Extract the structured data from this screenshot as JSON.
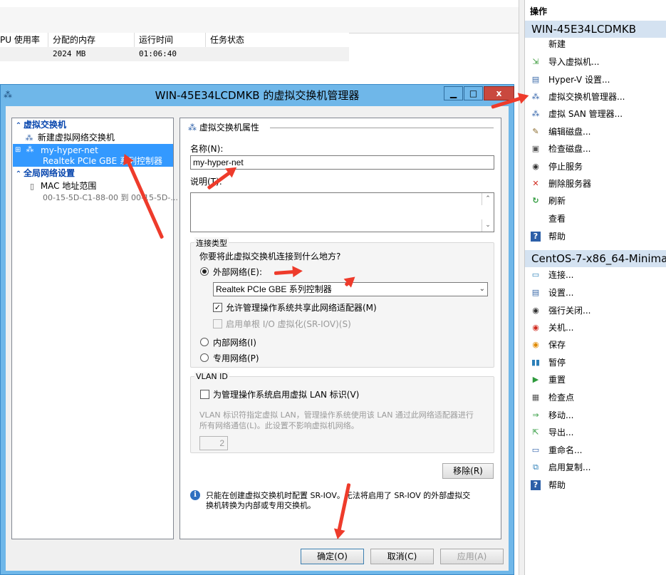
{
  "background": {
    "columns": [
      "PU 使用率",
      "分配的内存",
      "运行时间",
      "任务状态"
    ],
    "row": [
      "",
      "2024 MB",
      "01:06:40",
      ""
    ]
  },
  "actions": {
    "header": "操作",
    "host_group": "WIN-45E34LCDMKB",
    "host_items": [
      {
        "label": "新建",
        "icon": ""
      },
      {
        "label": "导入虚拟机...",
        "icon": "import-icon"
      },
      {
        "label": "Hyper-V 设置...",
        "icon": "settings-icon"
      },
      {
        "label": "虚拟交换机管理器...",
        "icon": "switch-manager-icon"
      },
      {
        "label": "虚拟 SAN 管理器...",
        "icon": "san-icon"
      },
      {
        "label": "编辑磁盘...",
        "icon": "edit-disk-icon"
      },
      {
        "label": "检查磁盘...",
        "icon": "inspect-disk-icon"
      },
      {
        "label": "停止服务",
        "icon": "stop-icon"
      },
      {
        "label": "删除服务器",
        "icon": "delete-icon"
      },
      {
        "label": "刷新",
        "icon": "refresh-icon"
      },
      {
        "label": "查看",
        "icon": ""
      },
      {
        "label": "帮助",
        "icon": "help-icon"
      }
    ],
    "vm_group": "CentOS-7-x86_64-Minimal",
    "vm_items": [
      {
        "label": "连接...",
        "icon": "connect-icon"
      },
      {
        "label": "设置...",
        "icon": "settings-icon"
      },
      {
        "label": "强行关闭...",
        "icon": "turn-off-icon"
      },
      {
        "label": "关机...",
        "icon": "shutdown-icon"
      },
      {
        "label": "保存",
        "icon": "save-icon"
      },
      {
        "label": "暂停",
        "icon": "pause-icon"
      },
      {
        "label": "重置",
        "icon": "reset-icon"
      },
      {
        "label": "检查点",
        "icon": "checkpoint-icon"
      },
      {
        "label": "移动...",
        "icon": "move-icon"
      },
      {
        "label": "导出...",
        "icon": "export-icon"
      },
      {
        "label": "重命名...",
        "icon": "rename-icon"
      },
      {
        "label": "启用复制...",
        "icon": "replication-icon"
      },
      {
        "label": "帮助",
        "icon": "help-icon"
      }
    ]
  },
  "dialog": {
    "title": "WIN-45E34LCDMKB 的虚拟交换机管理器",
    "minimize": "▁",
    "maximize": "□",
    "close": "x",
    "tree": {
      "section1": "虚拟交换机",
      "new_switch": "新建虚拟网络交换机",
      "switch_name": "my-hyper-net",
      "switch_adapter": "Realtek PCIe GBE 系列控制器",
      "section2": "全局网络设置",
      "mac_range": "MAC 地址范围",
      "mac_value": "00-15-5D-C1-88-00 到 00-15-5D-..."
    },
    "props": {
      "title": "虚拟交换机属性",
      "name_label": "名称(N):",
      "name_value": "my-hyper-net",
      "desc_label": "说明(T):",
      "conn_group": "连接类型",
      "conn_question": "你要将此虚拟交换机连接到什么地方?",
      "external": "外部网络(E):",
      "adapter": "Realtek PCIe GBE 系列控制器",
      "allow_share": "允许管理操作系统共享此网络适配器(M)",
      "sriov": "启用单根 I/O 虚拟化(SR-IOV)(S)",
      "internal": "内部网络(I)",
      "private": "专用网络(P)",
      "vlan_group": "VLAN ID",
      "vlan_check": "为管理操作系统启用虚拟 LAN 标识(V)",
      "vlan_desc_line1": "VLAN 标识符指定虚拟 LAN，管理操作系统使用该 LAN 通过此网络适配器进行",
      "vlan_desc_line2": "所有网络通信(L)。此设置不影响虚拟机网络。",
      "vlan_value": "2",
      "remove": "移除(R)",
      "info_line1": "只能在创建虚拟交换机时配置 SR-IOV。无法将启用了 SR-IOV 的外部虚拟交",
      "info_line2": "换机转换为内部或专用交换机。"
    },
    "buttons": {
      "ok": "确定(O)",
      "cancel": "取消(C)",
      "apply": "应用(A)"
    }
  },
  "colors": {
    "dialog_frame": "#6fb7e9",
    "selection": "#3399ff",
    "group_header": "#d4e2f1",
    "close_button": "#c9483e",
    "annotation_arrow": "#ee3b2b"
  }
}
